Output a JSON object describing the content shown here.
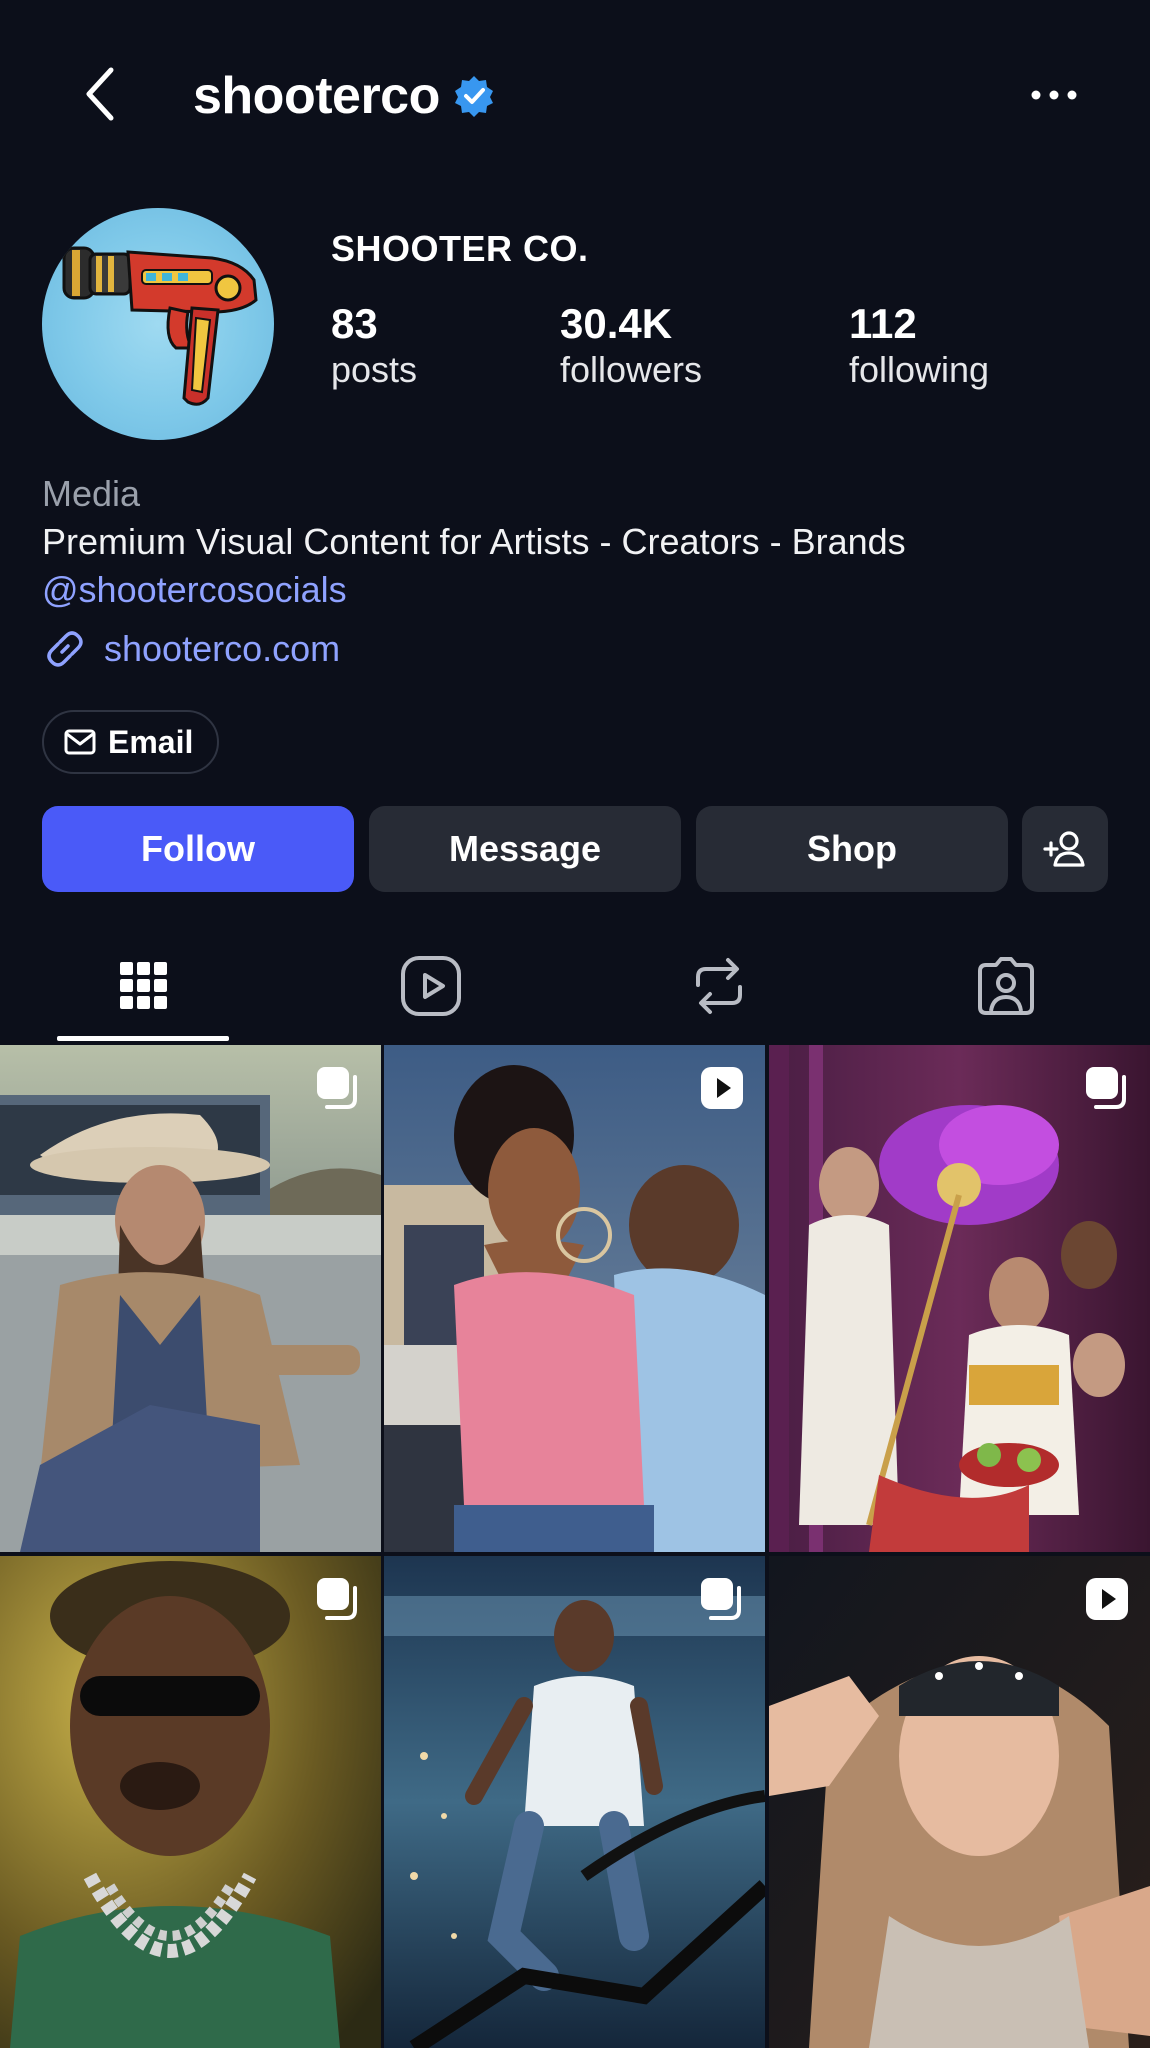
{
  "header": {
    "handle": "shooterco",
    "back_icon": "chevron-left-icon",
    "verified_icon": "verified-badge-icon",
    "more_icon": "more-horizontal-icon"
  },
  "profile": {
    "display_name": "SHOOTER CO.",
    "avatar_icon": "ray-gun-logo",
    "stats": [
      {
        "value": "83",
        "label": "posts"
      },
      {
        "value": "30.4K",
        "label": "followers"
      },
      {
        "value": "112",
        "label": "following"
      }
    ],
    "category": "Media",
    "bio": "Premium Visual Content for Artists - Creators - Brands",
    "mention": "@shootercosocials",
    "link": "shooterco.com",
    "link_icon": "link-icon"
  },
  "contact": {
    "email_label": "Email",
    "email_icon": "mail-icon"
  },
  "actions": {
    "follow": "Follow",
    "message": "Message",
    "shop": "Shop",
    "suggest_icon": "add-person-icon"
  },
  "tabs": [
    {
      "icon": "grid-icon",
      "active": true
    },
    {
      "icon": "reels-icon",
      "active": false
    },
    {
      "icon": "reposts-icon",
      "active": false
    },
    {
      "icon": "tagged-icon",
      "active": false
    }
  ],
  "posts": [
    {
      "badge": "carousel-icon",
      "subject": "man in cowboy hat on pickup truck"
    },
    {
      "badge": "reel-icon",
      "subject": "woman in pink top with man in sunglasses"
    },
    {
      "badge": "carousel-icon",
      "subject": "toga-clad group scene with purple feathers"
    },
    {
      "badge": "carousel-icon",
      "subject": "man with sunglasses and chains"
    },
    {
      "badge": "carousel-icon",
      "subject": "runner on treadmill"
    },
    {
      "badge": "reel-icon",
      "subject": "young man in hoodie and bandana"
    }
  ],
  "colors": {
    "background": "#0c0f1a",
    "follow_button": "#4a5af8",
    "secondary_button": "#272b35",
    "link": "#8fa2ff",
    "verified": "#3897f0"
  }
}
